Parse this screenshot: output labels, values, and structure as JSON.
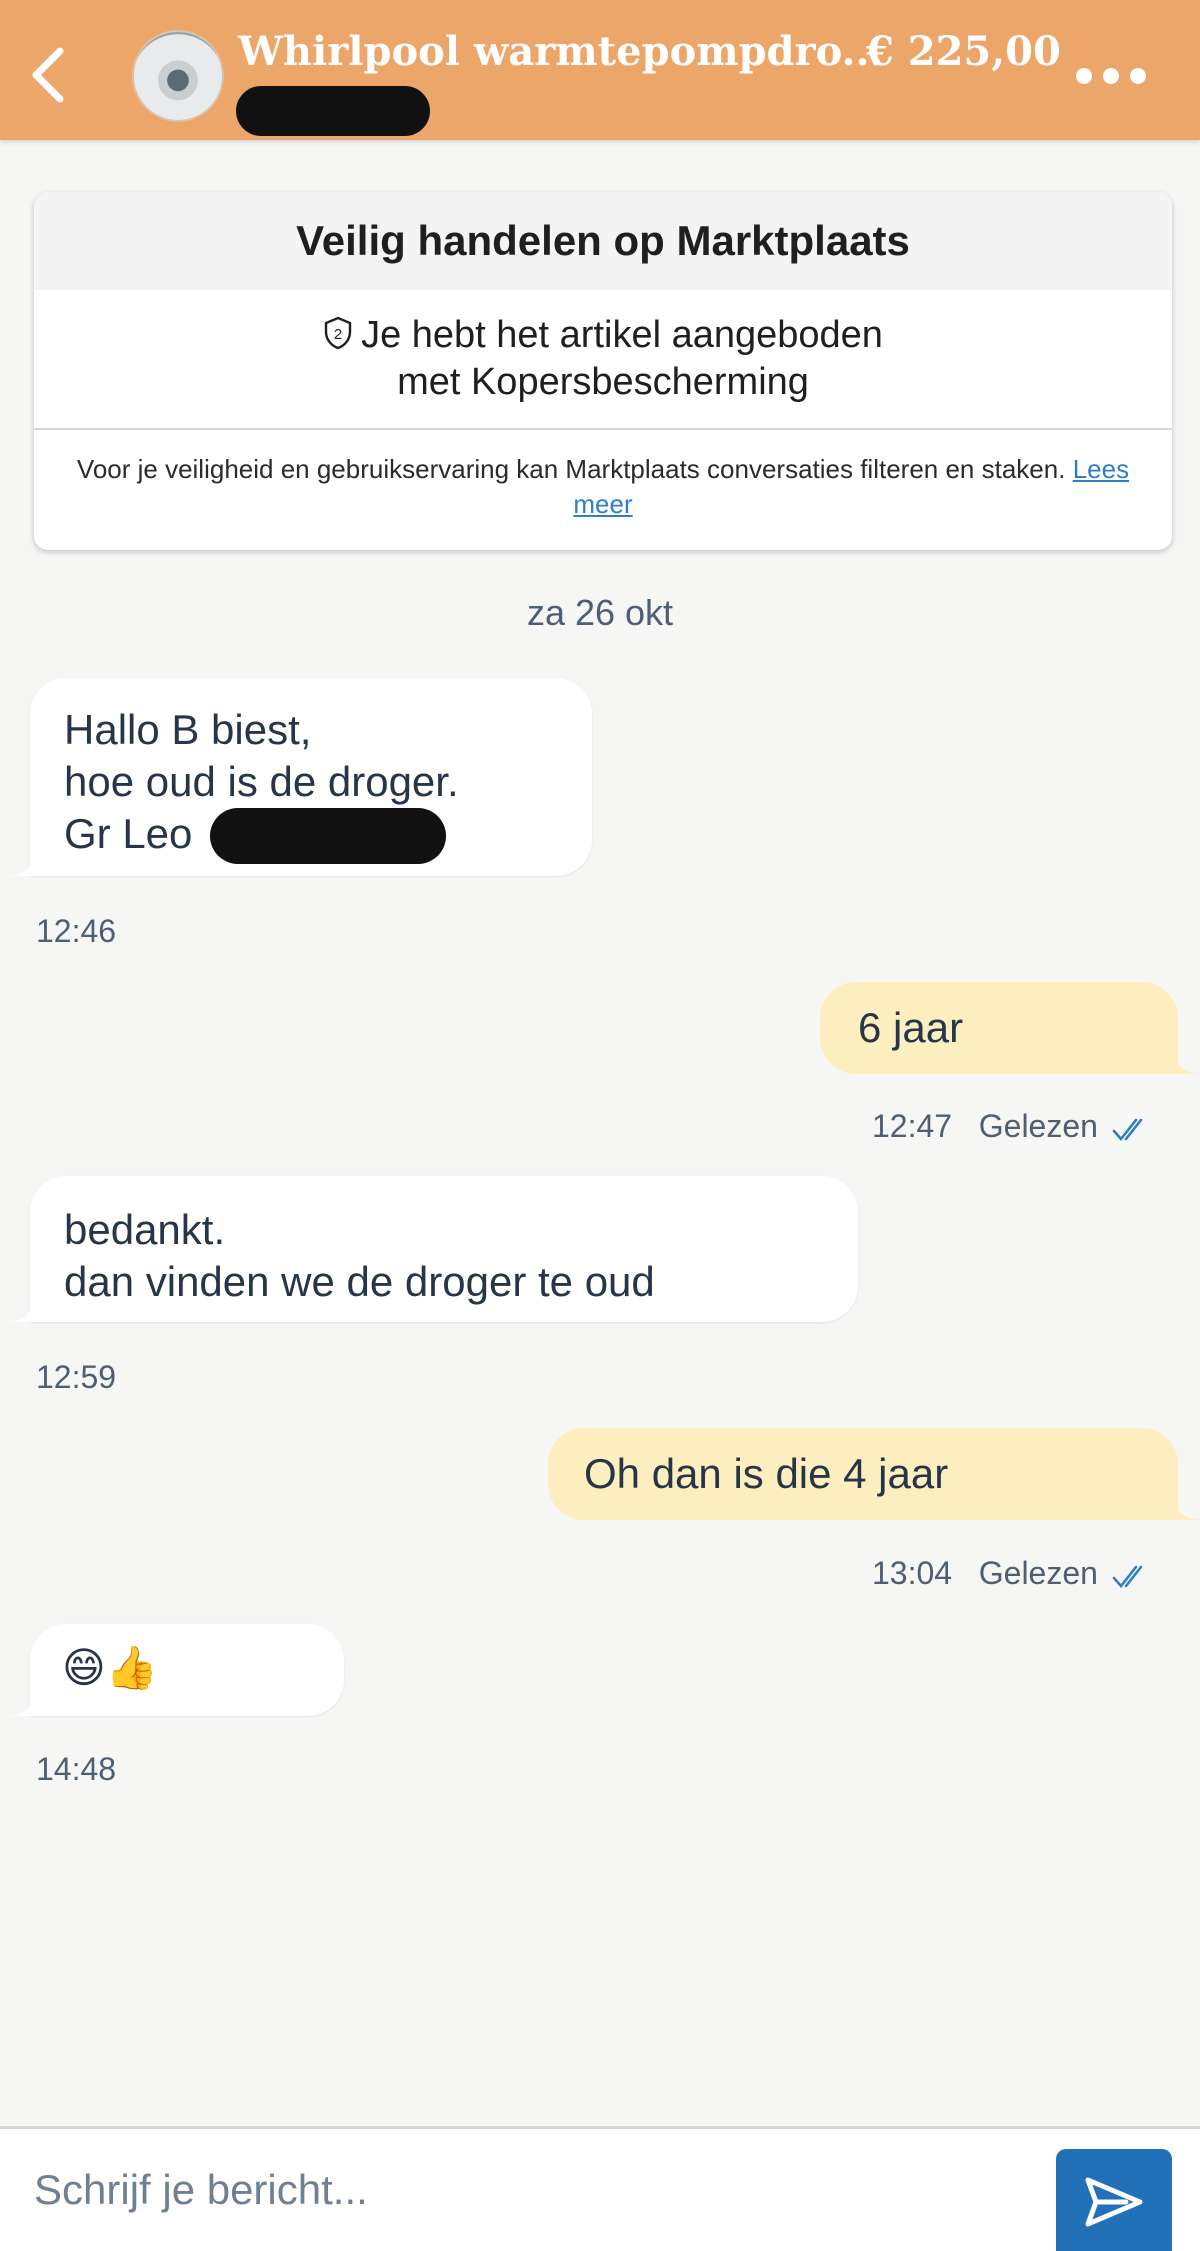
{
  "header": {
    "title": "Whirlpool warmtepompdro...",
    "price": "€ 225,00",
    "back_icon": "chevron-left-icon",
    "menu_icon": "more-dots-icon"
  },
  "safety": {
    "heading": "Veilig handelen op Marktplaats",
    "line1": "Je hebt het artikel aangeboden",
    "line2": "met Kopersbescherming",
    "notice": "Voor je veiligheid en gebruikservaring kan Marktplaats conversaties filteren en staken.",
    "link": "Lees meer"
  },
  "conversation": {
    "date": "za 26 okt",
    "messages": [
      {
        "direction": "in",
        "lines": [
          "Hallo B biest,",
          "hoe oud is de droger.",
          "Gr Leo"
        ],
        "time": "12:46"
      },
      {
        "direction": "out",
        "text": "6 jaar",
        "time": "12:47",
        "status": "Gelezen"
      },
      {
        "direction": "in",
        "lines": [
          "bedankt.",
          "dan vinden we de droger te oud"
        ],
        "time": "12:59"
      },
      {
        "direction": "out",
        "text": "Oh dan is die 4 jaar",
        "time": "13:04",
        "status": "Gelezen"
      },
      {
        "direction": "in",
        "text": "😄👍",
        "time": "14:48"
      }
    ]
  },
  "compose": {
    "placeholder": "Schrijf je bericht...",
    "send_icon": "send-icon"
  },
  "colors": {
    "header": "#eda66a",
    "outgoing_bubble": "#fdeebf",
    "incoming_bubble": "#ffffff",
    "send_button": "#2270b8",
    "link": "#2f7fc4"
  }
}
